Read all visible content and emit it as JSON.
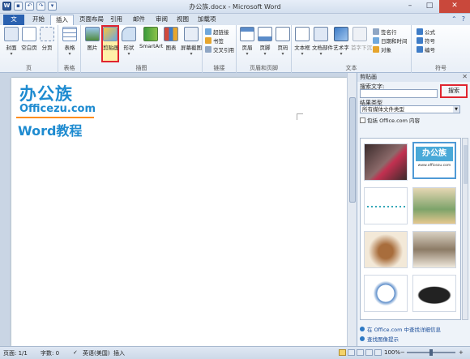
{
  "window": {
    "title": "办公族.docx - Microsoft Word",
    "controls": [
      "–",
      "□",
      "✕"
    ]
  },
  "tabs": [
    "文件",
    "开始",
    "插入",
    "页面布局",
    "引用",
    "邮件",
    "审阅",
    "视图",
    "加载项"
  ],
  "ribbon": {
    "pages": {
      "label": "页",
      "items": [
        "封面",
        "空白页",
        "分页"
      ]
    },
    "tables": {
      "label": "表格",
      "items": [
        "表格"
      ]
    },
    "illustrations": {
      "label": "插图",
      "items": [
        "图片",
        "剪贴画",
        "形状",
        "SmartArt",
        "图表",
        "屏幕截图"
      ]
    },
    "links": {
      "label": "链接",
      "items": [
        "超链接",
        "书签",
        "交叉引用"
      ]
    },
    "header_footer": {
      "label": "页眉和页脚",
      "items": [
        "页眉",
        "页脚",
        "页码"
      ]
    },
    "text": {
      "label": "文本",
      "items": [
        "文本框",
        "文档部件",
        "艺术字",
        "首字下沉"
      ],
      "small": [
        "签名行",
        "日期和时间",
        "对象"
      ]
    },
    "symbols": {
      "label": "符号",
      "small": [
        "公式",
        "符号",
        "编号"
      ]
    }
  },
  "document": {
    "logo_main": "办公族",
    "logo_sub": "Officezu.com",
    "logo_word": "Word教程"
  },
  "pane": {
    "title": "剪贴画",
    "search_label": "搜索文字:",
    "search_value": "",
    "search_button": "搜索",
    "result_type_label": "结果类型",
    "result_type_value": "所有媒体文件类型",
    "include_label": "包括 Office.com 内容",
    "thumb2_title": "办公族",
    "thumb2_sub": "www.officezu.com",
    "link1": "在 Office.com 中查找详细信息",
    "link2": "查找图像提示"
  },
  "statusbar": {
    "page": "页面: 1/1",
    "words": "字数: 0",
    "language": "英语(美国)",
    "mode": "插入",
    "zoom": "100%",
    "zoom_minus": "−",
    "zoom_plus": "+"
  },
  "colors": {
    "accent_blue": "#1e8bd0",
    "accent_orange": "#ff7a00",
    "highlight_red": "#e0242f",
    "file_tab": "#2a61b0"
  }
}
